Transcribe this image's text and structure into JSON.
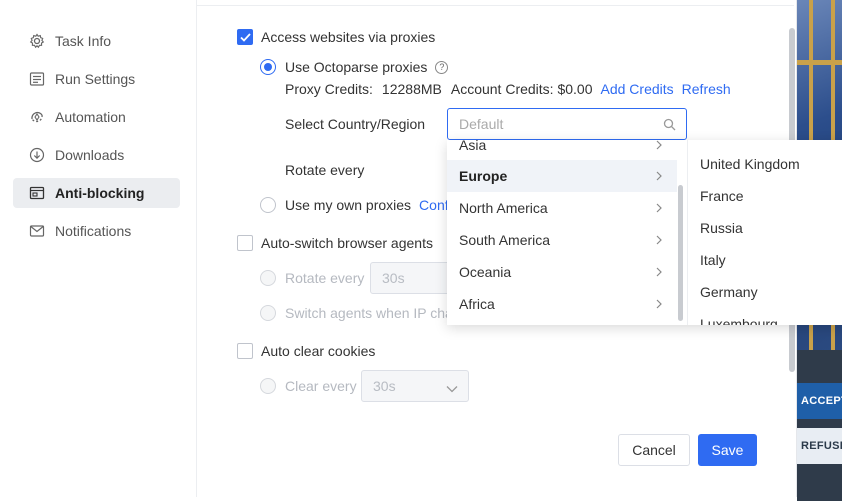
{
  "sidebar": {
    "items": [
      {
        "label": "Task Info",
        "icon": "gear-icon"
      },
      {
        "label": "Run Settings",
        "icon": "list-icon"
      },
      {
        "label": "Automation",
        "icon": "automation-icon"
      },
      {
        "label": "Downloads",
        "icon": "download-icon"
      },
      {
        "label": "Anti-blocking",
        "icon": "browser-shield-icon",
        "active": true
      },
      {
        "label": "Notifications",
        "icon": "mail-icon"
      }
    ]
  },
  "proxies": {
    "access_label": "Access websites via proxies",
    "use_octoparse_label": "Use Octoparse proxies",
    "credits_label": "Proxy Credits:",
    "credits_value": "12288MB",
    "account_credits": "Account Credits: $0.00",
    "add_credits": "Add Credits",
    "refresh": "Refresh",
    "country_label": "Select Country/Region",
    "country_placeholder": "Default",
    "rotate_label": "Rotate every",
    "own_proxies_label": "Use my own proxies",
    "own_proxies_link": "Conf"
  },
  "agents": {
    "switch_label": "Auto-switch browser agents",
    "rotate_label": "Rotate every",
    "rotate_value": "30s",
    "switch_ip_label": "Switch agents when IP cha"
  },
  "cookies": {
    "label": "Auto clear cookies",
    "clear_label": "Clear every",
    "clear_value": "30s"
  },
  "dropdown": {
    "regions": [
      "Asia",
      "Europe",
      "North America",
      "South America",
      "Oceania",
      "Africa"
    ],
    "active_region": "Europe",
    "countries": [
      "United Kingdom",
      "France",
      "Russia",
      "Italy",
      "Germany",
      "Luxembourg"
    ]
  },
  "footer": {
    "cancel": "Cancel",
    "save": "Save"
  },
  "background": {
    "accept": "ACCEPT",
    "refuse": "REFUSE"
  },
  "colors": {
    "accent": "#2f6bf2"
  }
}
